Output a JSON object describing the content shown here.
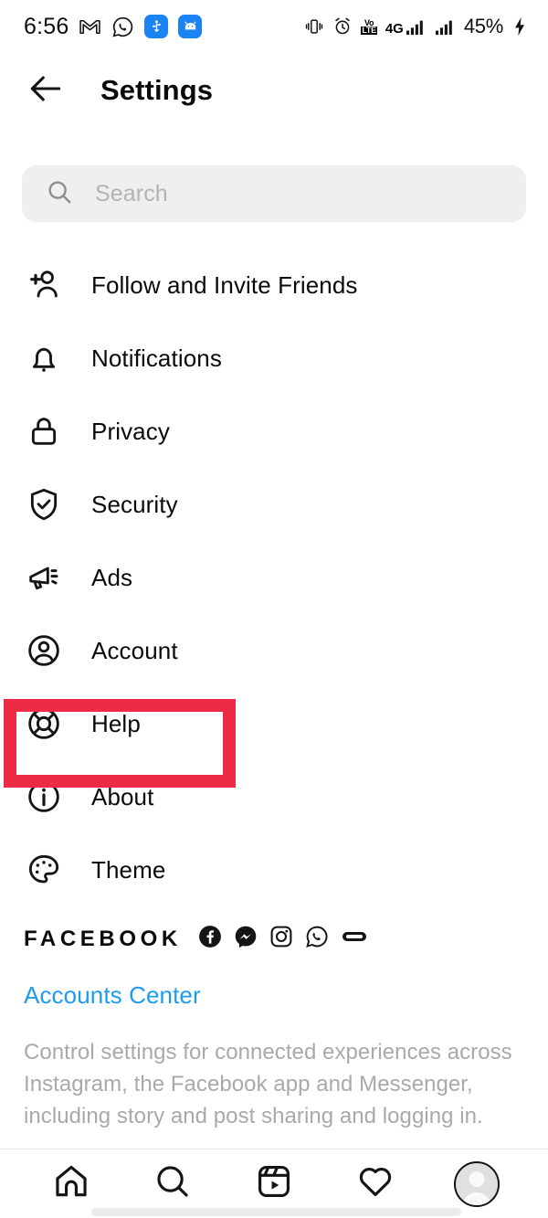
{
  "status_bar": {
    "time": "6:56",
    "left_icons": [
      "gmail-icon",
      "whatsapp-icon",
      "usb-icon",
      "android-messages-icon"
    ],
    "right_icons": [
      "vibrate-icon",
      "alarm-icon",
      "volte-icon",
      "signal-4g-icon",
      "signal-bars-icon"
    ],
    "network_label": "4G",
    "volte_top": "Vo",
    "volte_bottom": "LTE",
    "battery_percent": "45%",
    "charging": true
  },
  "header": {
    "back_label": "back-arrow",
    "title": "Settings"
  },
  "search": {
    "placeholder": "Search",
    "value": "",
    "icon": "search-icon"
  },
  "settings_items": [
    {
      "id": "follow-invite-friends",
      "label": "Follow and Invite Friends",
      "icon": "person-add-icon",
      "highlighted": false
    },
    {
      "id": "notifications",
      "label": "Notifications",
      "icon": "bell-icon",
      "highlighted": false
    },
    {
      "id": "privacy",
      "label": "Privacy",
      "icon": "lock-icon",
      "highlighted": false
    },
    {
      "id": "security",
      "label": "Security",
      "icon": "shield-check-icon",
      "highlighted": true
    },
    {
      "id": "ads",
      "label": "Ads",
      "icon": "megaphone-icon",
      "highlighted": false
    },
    {
      "id": "account",
      "label": "Account",
      "icon": "account-circle-icon",
      "highlighted": false
    },
    {
      "id": "help",
      "label": "Help",
      "icon": "lifebuoy-icon",
      "highlighted": false
    },
    {
      "id": "about",
      "label": "About",
      "icon": "info-circle-icon",
      "highlighted": false
    },
    {
      "id": "theme",
      "label": "Theme",
      "icon": "palette-icon",
      "highlighted": false
    }
  ],
  "facebook_section": {
    "heading": "FACEBOOK",
    "brand_icons": [
      "facebook-icon",
      "messenger-icon",
      "instagram-icon",
      "whatsapp-icon",
      "portal-icon"
    ],
    "accounts_center_link": "Accounts Center",
    "description": "Control settings for connected experiences across Instagram, the Facebook app and Messenger, including story and post sharing and logging in."
  },
  "bottom_nav": [
    {
      "id": "home",
      "icon": "home-icon"
    },
    {
      "id": "search",
      "icon": "search-icon"
    },
    {
      "id": "reels",
      "icon": "reels-icon"
    },
    {
      "id": "activity",
      "icon": "heart-icon"
    },
    {
      "id": "profile",
      "icon": "profile-avatar-icon"
    }
  ],
  "colors": {
    "highlight_red": "#ed2b44",
    "link_blue": "#1c9bef",
    "search_bg": "#efefef",
    "muted_text": "#a9a9a9"
  }
}
